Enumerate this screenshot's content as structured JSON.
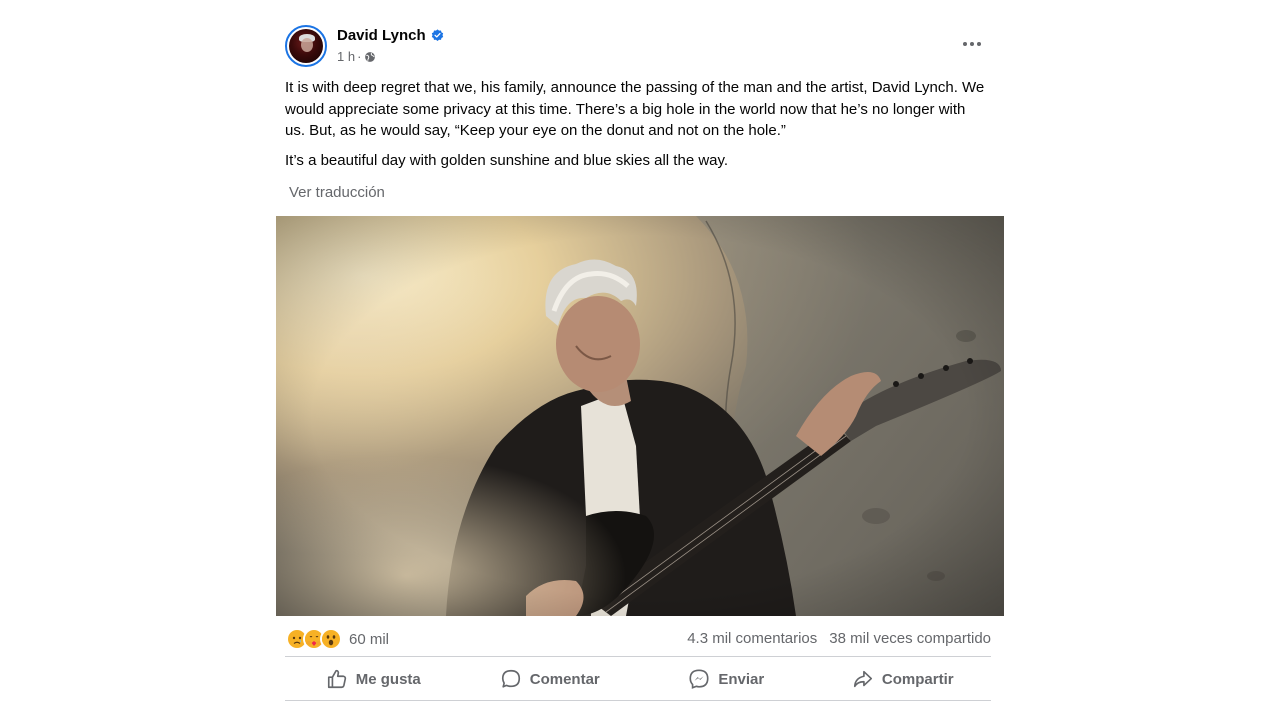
{
  "post": {
    "author": "David Lynch",
    "verified": true,
    "time": "1 h",
    "separator": "·",
    "privacy_icon": "globe-icon",
    "more_icon": "more-horizontal-icon",
    "paragraphs": [
      "It is with deep regret that we, his family, announce the passing of the man and the artist, David Lynch.  We would appreciate some privacy at this time.  There’s a big hole in the world now that he’s no longer with us.  But, as he would say, “Keep your eye on the donut and not on the hole.”",
      "It’s a beautiful day with golden sunshine and blue skies all the way."
    ],
    "translate_label": "Ver traducción",
    "photo": {
      "description_icon": "photo-man-with-guitar"
    }
  },
  "stats": {
    "reaction_icons": [
      "sad-reaction-icon",
      "care-reaction-icon",
      "wow-reaction-icon"
    ],
    "reactions_count": "60 mil",
    "comments": "4.3 mil comentarios",
    "shares": "38 mil veces compartido"
  },
  "actions": {
    "like": "Me gusta",
    "comment": "Comentar",
    "send": "Enviar",
    "share": "Compartir"
  },
  "colors": {
    "verified_blue": "#1b74e4",
    "secondary_text": "#65676b",
    "primary_text": "#050505",
    "divider": "#ced0d4",
    "reaction_yellow": "#f7b125"
  }
}
